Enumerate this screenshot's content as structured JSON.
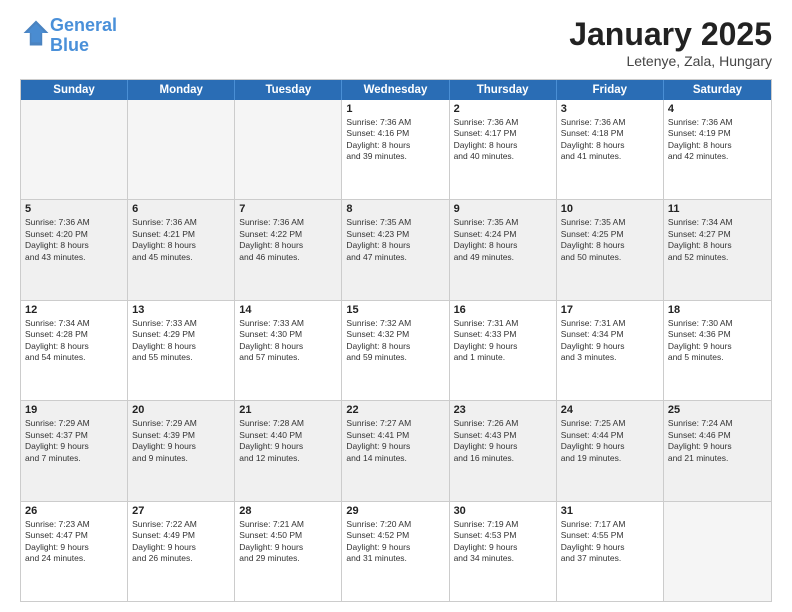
{
  "header": {
    "logo_line1": "General",
    "logo_line2": "Blue",
    "main_title": "January 2025",
    "subtitle": "Letenye, Zala, Hungary"
  },
  "calendar": {
    "days_of_week": [
      "Sunday",
      "Monday",
      "Tuesday",
      "Wednesday",
      "Thursday",
      "Friday",
      "Saturday"
    ],
    "weeks": [
      {
        "cells": [
          {
            "empty": true
          },
          {
            "empty": true
          },
          {
            "empty": true
          },
          {
            "day": "1",
            "lines": [
              "Sunrise: 7:36 AM",
              "Sunset: 4:16 PM",
              "Daylight: 8 hours",
              "and 39 minutes."
            ]
          },
          {
            "day": "2",
            "lines": [
              "Sunrise: 7:36 AM",
              "Sunset: 4:17 PM",
              "Daylight: 8 hours",
              "and 40 minutes."
            ]
          },
          {
            "day": "3",
            "lines": [
              "Sunrise: 7:36 AM",
              "Sunset: 4:18 PM",
              "Daylight: 8 hours",
              "and 41 minutes."
            ]
          },
          {
            "day": "4",
            "lines": [
              "Sunrise: 7:36 AM",
              "Sunset: 4:19 PM",
              "Daylight: 8 hours",
              "and 42 minutes."
            ]
          }
        ]
      },
      {
        "cells": [
          {
            "day": "5",
            "lines": [
              "Sunrise: 7:36 AM",
              "Sunset: 4:20 PM",
              "Daylight: 8 hours",
              "and 43 minutes."
            ]
          },
          {
            "day": "6",
            "lines": [
              "Sunrise: 7:36 AM",
              "Sunset: 4:21 PM",
              "Daylight: 8 hours",
              "and 45 minutes."
            ]
          },
          {
            "day": "7",
            "lines": [
              "Sunrise: 7:36 AM",
              "Sunset: 4:22 PM",
              "Daylight: 8 hours",
              "and 46 minutes."
            ]
          },
          {
            "day": "8",
            "lines": [
              "Sunrise: 7:35 AM",
              "Sunset: 4:23 PM",
              "Daylight: 8 hours",
              "and 47 minutes."
            ]
          },
          {
            "day": "9",
            "lines": [
              "Sunrise: 7:35 AM",
              "Sunset: 4:24 PM",
              "Daylight: 8 hours",
              "and 49 minutes."
            ]
          },
          {
            "day": "10",
            "lines": [
              "Sunrise: 7:35 AM",
              "Sunset: 4:25 PM",
              "Daylight: 8 hours",
              "and 50 minutes."
            ]
          },
          {
            "day": "11",
            "lines": [
              "Sunrise: 7:34 AM",
              "Sunset: 4:27 PM",
              "Daylight: 8 hours",
              "and 52 minutes."
            ]
          }
        ]
      },
      {
        "cells": [
          {
            "day": "12",
            "lines": [
              "Sunrise: 7:34 AM",
              "Sunset: 4:28 PM",
              "Daylight: 8 hours",
              "and 54 minutes."
            ]
          },
          {
            "day": "13",
            "lines": [
              "Sunrise: 7:33 AM",
              "Sunset: 4:29 PM",
              "Daylight: 8 hours",
              "and 55 minutes."
            ]
          },
          {
            "day": "14",
            "lines": [
              "Sunrise: 7:33 AM",
              "Sunset: 4:30 PM",
              "Daylight: 8 hours",
              "and 57 minutes."
            ]
          },
          {
            "day": "15",
            "lines": [
              "Sunrise: 7:32 AM",
              "Sunset: 4:32 PM",
              "Daylight: 8 hours",
              "and 59 minutes."
            ]
          },
          {
            "day": "16",
            "lines": [
              "Sunrise: 7:31 AM",
              "Sunset: 4:33 PM",
              "Daylight: 9 hours",
              "and 1 minute."
            ]
          },
          {
            "day": "17",
            "lines": [
              "Sunrise: 7:31 AM",
              "Sunset: 4:34 PM",
              "Daylight: 9 hours",
              "and 3 minutes."
            ]
          },
          {
            "day": "18",
            "lines": [
              "Sunrise: 7:30 AM",
              "Sunset: 4:36 PM",
              "Daylight: 9 hours",
              "and 5 minutes."
            ]
          }
        ]
      },
      {
        "cells": [
          {
            "day": "19",
            "lines": [
              "Sunrise: 7:29 AM",
              "Sunset: 4:37 PM",
              "Daylight: 9 hours",
              "and 7 minutes."
            ]
          },
          {
            "day": "20",
            "lines": [
              "Sunrise: 7:29 AM",
              "Sunset: 4:39 PM",
              "Daylight: 9 hours",
              "and 9 minutes."
            ]
          },
          {
            "day": "21",
            "lines": [
              "Sunrise: 7:28 AM",
              "Sunset: 4:40 PM",
              "Daylight: 9 hours",
              "and 12 minutes."
            ]
          },
          {
            "day": "22",
            "lines": [
              "Sunrise: 7:27 AM",
              "Sunset: 4:41 PM",
              "Daylight: 9 hours",
              "and 14 minutes."
            ]
          },
          {
            "day": "23",
            "lines": [
              "Sunrise: 7:26 AM",
              "Sunset: 4:43 PM",
              "Daylight: 9 hours",
              "and 16 minutes."
            ]
          },
          {
            "day": "24",
            "lines": [
              "Sunrise: 7:25 AM",
              "Sunset: 4:44 PM",
              "Daylight: 9 hours",
              "and 19 minutes."
            ]
          },
          {
            "day": "25",
            "lines": [
              "Sunrise: 7:24 AM",
              "Sunset: 4:46 PM",
              "Daylight: 9 hours",
              "and 21 minutes."
            ]
          }
        ]
      },
      {
        "cells": [
          {
            "day": "26",
            "lines": [
              "Sunrise: 7:23 AM",
              "Sunset: 4:47 PM",
              "Daylight: 9 hours",
              "and 24 minutes."
            ]
          },
          {
            "day": "27",
            "lines": [
              "Sunrise: 7:22 AM",
              "Sunset: 4:49 PM",
              "Daylight: 9 hours",
              "and 26 minutes."
            ]
          },
          {
            "day": "28",
            "lines": [
              "Sunrise: 7:21 AM",
              "Sunset: 4:50 PM",
              "Daylight: 9 hours",
              "and 29 minutes."
            ]
          },
          {
            "day": "29",
            "lines": [
              "Sunrise: 7:20 AM",
              "Sunset: 4:52 PM",
              "Daylight: 9 hours",
              "and 31 minutes."
            ]
          },
          {
            "day": "30",
            "lines": [
              "Sunrise: 7:19 AM",
              "Sunset: 4:53 PM",
              "Daylight: 9 hours",
              "and 34 minutes."
            ]
          },
          {
            "day": "31",
            "lines": [
              "Sunrise: 7:17 AM",
              "Sunset: 4:55 PM",
              "Daylight: 9 hours",
              "and 37 minutes."
            ]
          },
          {
            "empty": true
          }
        ]
      }
    ]
  }
}
